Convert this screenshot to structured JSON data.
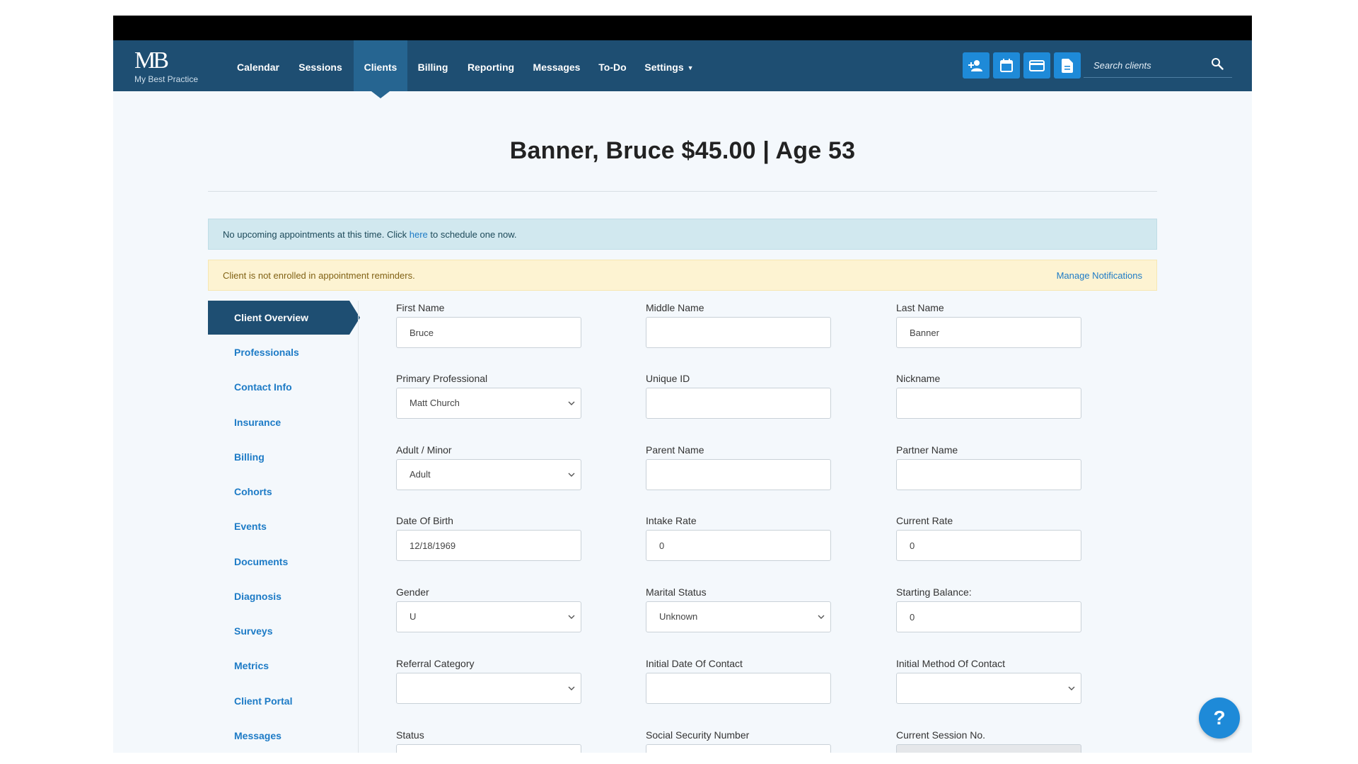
{
  "app": {
    "logo_mark": "MB",
    "logo_text": "My Best Practice"
  },
  "nav": {
    "items": [
      "Calendar",
      "Sessions",
      "Clients",
      "Billing",
      "Reporting",
      "Messages",
      "To-Do",
      "Settings"
    ],
    "active": "Clients",
    "search_placeholder": "Search clients",
    "quick_icons": [
      "add-client-icon",
      "calendar-icon",
      "credit-card-icon",
      "document-icon"
    ]
  },
  "page": {
    "title": "Banner, Bruce $45.00 | Age 53"
  },
  "alerts": {
    "info_before": "No upcoming appointments at this time. Click ",
    "info_link": "here",
    "info_after": " to schedule one now.",
    "warning": "Client is not enrolled in appointment reminders.",
    "warning_link": "Manage Notifications"
  },
  "sidebar": {
    "active": "Client Overview",
    "items": [
      "Client Overview",
      "Professionals",
      "Contact Info",
      "Insurance",
      "Billing",
      "Cohorts",
      "Events",
      "Documents",
      "Diagnosis",
      "Surveys",
      "Metrics",
      "Client Portal",
      "Messages"
    ]
  },
  "form": {
    "first_name": {
      "label": "First Name",
      "value": "Bruce"
    },
    "middle_name": {
      "label": "Middle Name",
      "value": ""
    },
    "last_name": {
      "label": "Last Name",
      "value": "Banner"
    },
    "primary_professional": {
      "label": "Primary Professional",
      "value": "Matt Church"
    },
    "unique_id": {
      "label": "Unique ID",
      "value": ""
    },
    "nickname": {
      "label": "Nickname",
      "value": ""
    },
    "adult_minor": {
      "label": "Adult / Minor",
      "value": "Adult"
    },
    "parent_name": {
      "label": "Parent Name",
      "value": ""
    },
    "partner_name": {
      "label": "Partner Name",
      "value": ""
    },
    "date_of_birth": {
      "label": "Date Of Birth",
      "value": "12/18/1969"
    },
    "intake_rate": {
      "label": "Intake Rate",
      "value": "0"
    },
    "current_rate": {
      "label": "Current Rate",
      "value": "0"
    },
    "gender": {
      "label": "Gender",
      "value": "U"
    },
    "marital_status": {
      "label": "Marital Status",
      "value": "Unknown"
    },
    "starting_balance": {
      "label": "Starting Balance:",
      "value": "0"
    },
    "referral_category": {
      "label": "Referral Category",
      "value": ""
    },
    "initial_date_of_contact": {
      "label": "Initial Date Of Contact",
      "value": ""
    },
    "initial_method_of_contact": {
      "label": "Initial Method Of Contact",
      "value": ""
    },
    "status": {
      "label": "Status",
      "value": ""
    },
    "ssn": {
      "label": "Social Security Number",
      "value": ""
    },
    "current_session_no": {
      "label": "Current Session No.",
      "value": ""
    }
  },
  "help": {
    "label": "?"
  },
  "colors": {
    "nav_bg": "#1e4e72",
    "nav_active": "#266591",
    "accent": "#1e8ad8",
    "link": "#1d7bc6",
    "info_bg": "#d1e8ef",
    "warn_bg": "#fdf3d2"
  }
}
